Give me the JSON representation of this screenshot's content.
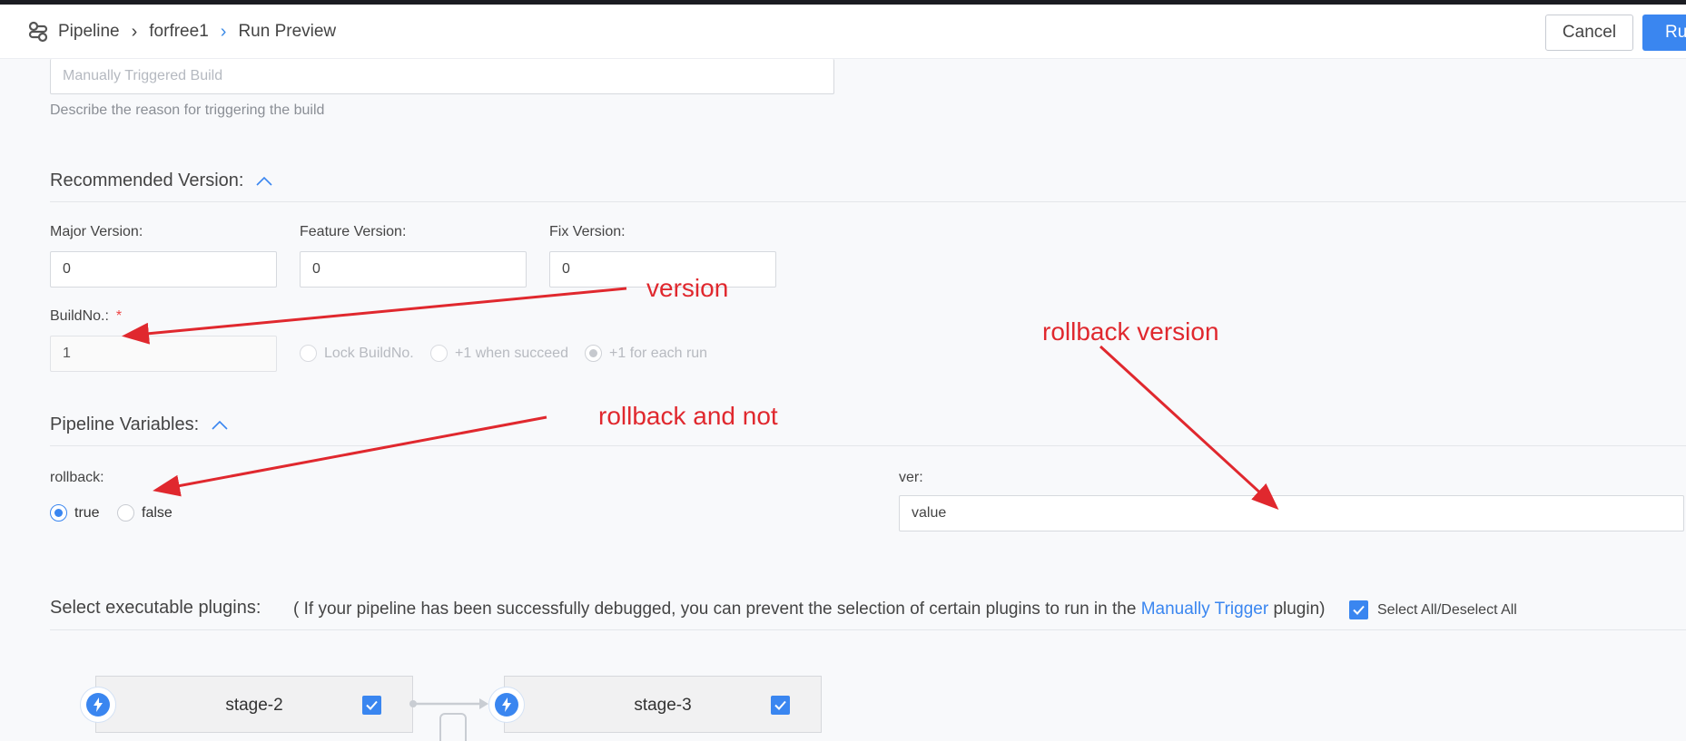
{
  "header": {
    "breadcrumb": [
      "Pipeline",
      "forfree1",
      "Run Preview"
    ],
    "cancel_label": "Cancel",
    "run_label": "Run"
  },
  "build_message": {
    "placeholder": "Manually Triggered Build",
    "hint": "Describe the reason for triggering the build"
  },
  "recommended_version": {
    "title": "Recommended Version:",
    "major_label": "Major Version:",
    "major_value": "0",
    "feature_label": "Feature Version:",
    "feature_value": "0",
    "fix_label": "Fix Version:",
    "fix_value": "0",
    "buildno_label": "BuildNo.:",
    "buildno_required": "*",
    "buildno_value": "1",
    "buildno_options": [
      "Lock BuildNo.",
      "+1 when succeed",
      "+1 for each run"
    ],
    "buildno_selected": "+1 for each run"
  },
  "pipeline_variables": {
    "title": "Pipeline Variables:",
    "rollback_label": "rollback:",
    "rollback_options": [
      "true",
      "false"
    ],
    "rollback_selected": "true",
    "ver_label": "ver:",
    "ver_value": "value"
  },
  "plugins": {
    "title": "Select executable plugins:",
    "note_prefix": "( If your pipeline has been successfully debugged, you can prevent the selection of certain plugins to run in the",
    "note_link": "Manually Trigger",
    "note_suffix": "plugin)",
    "select_all_label": "Select All/Deselect All",
    "select_all_checked": true,
    "stages": [
      {
        "name": "stage-2",
        "checked": true
      },
      {
        "name": "stage-3",
        "checked": true
      }
    ]
  },
  "annotations": {
    "version": "version",
    "rollback_version": "rollback version",
    "rollback_and_not": "rollback and not",
    "color": "#e0282e"
  },
  "colors": {
    "accent": "#3a86f0",
    "background": "#f8f9fb"
  }
}
